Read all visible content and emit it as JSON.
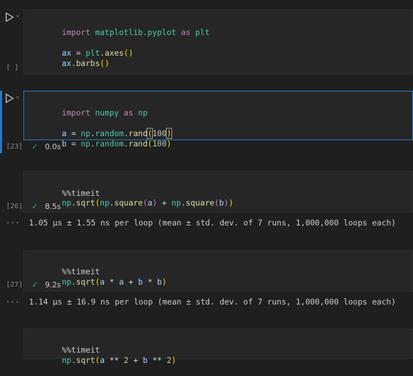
{
  "cells": [
    {
      "exec_count": "[ ]",
      "lines": [
        [
          "import",
          " ",
          "matplotlib.pyplot",
          " ",
          "as",
          " ",
          "plt"
        ],
        [],
        [
          "ax",
          " = ",
          "plt",
          ".",
          "axes",
          "(",
          ")"
        ],
        [
          "ax",
          ".",
          "barbs",
          "(",
          ")"
        ]
      ]
    },
    {
      "exec_count": "[23]",
      "status_time": "0.0s",
      "lines": [
        [
          "import",
          " ",
          "numpy",
          " ",
          "as",
          " ",
          "np"
        ],
        [],
        [
          "a",
          " = ",
          "np",
          ".",
          "random",
          ".",
          "rand",
          "(",
          "100",
          ")"
        ],
        [
          "b",
          " = ",
          "np",
          ".",
          "random",
          ".",
          "rand",
          "(",
          "100",
          ")"
        ]
      ]
    },
    {
      "exec_count": "[26]",
      "status_time": "8.5s",
      "lines": [
        [
          "%%timeit"
        ],
        [
          "np",
          ".",
          "sqrt",
          "(",
          "np",
          ".",
          "square",
          "(",
          "a",
          ")",
          " + ",
          "np",
          ".",
          "square",
          "(",
          "b",
          ")",
          ")"
        ]
      ],
      "output": "1.05 µs ± 1.55 ns per loop (mean ± std. dev. of 7 runs, 1,000,000 loops each)"
    },
    {
      "exec_count": "[27]",
      "status_time": "9.2s",
      "lines": [
        [
          "%%timeit"
        ],
        [
          "np",
          ".",
          "sqrt",
          "(",
          "a",
          " * ",
          "a",
          " + ",
          "b",
          " * ",
          "b",
          ")"
        ]
      ],
      "output": "1.14 µs ± 16.9 ns per loop (mean ± std. dev. of 7 runs, 1,000,000 loops each)"
    },
    {
      "lines": [
        [
          "%%timeit"
        ],
        [
          "np",
          ".",
          "sqrt",
          "(",
          "a",
          " ** ",
          "2",
          " + ",
          "b",
          " ** ",
          "2",
          ")"
        ]
      ]
    }
  ],
  "output_ellipsis": "···",
  "icons": {
    "run": "play-triangle-icon",
    "chevron": "chevron-down-icon",
    "check": "check-icon"
  },
  "colors": {
    "keyword": "#c586c0",
    "module": "#4ec9b0",
    "function": "#dcdcaa",
    "number": "#b5cea8",
    "variable": "#9cdcfe",
    "bracket_outer": "#ffd700",
    "bracket_inner": "#da70d6",
    "success": "#4fa84f",
    "focus": "#2b79c2"
  }
}
